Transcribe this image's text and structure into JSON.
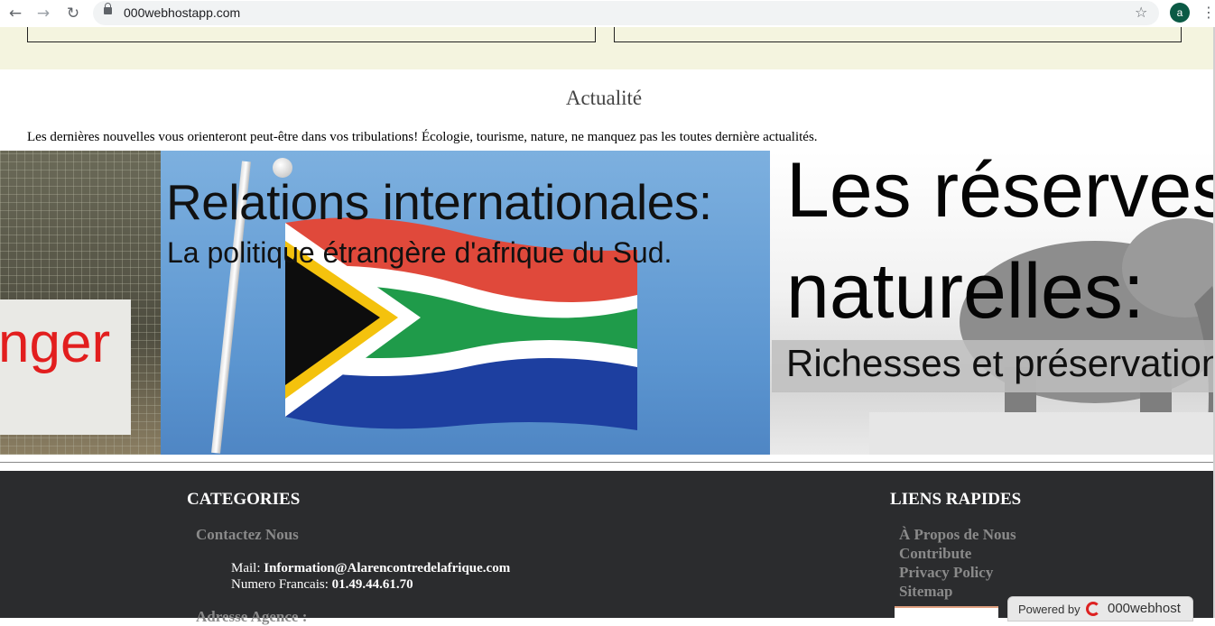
{
  "browser": {
    "url": "000webhostapp.com",
    "back_icon": "←",
    "forward_icon": "→",
    "reload_icon": "↻",
    "star_icon": "☆",
    "profile_initial": "a",
    "menu_icon": "⋮"
  },
  "news": {
    "title": "Actualité",
    "intro": "Les dernières nouvelles vous orienteront peut-être dans vos tribulations! Écologie, tourisme, nature, ne manquez pas les toutes dernière actualités.",
    "slides": {
      "left": {
        "text": "nger"
      },
      "middle": {
        "heading": "Relations internationales:",
        "subheading": "La politique étrangère d'afrique du Sud."
      },
      "right": {
        "line1": "Les réserves",
        "line2": "naturelles:",
        "tagline": "Richesses et préservation."
      }
    }
  },
  "footer": {
    "categories": {
      "heading": "CATEGORIES",
      "contact_link": "Contactez Nous",
      "mail_label": "Mail:",
      "mail_value": "Information@Alarencontredelafrique.com",
      "phone_label": "Numero Francais:",
      "phone_value": "01.49.44.61.70",
      "address_partial": "Adresse Agence :"
    },
    "quick_links": {
      "heading": "LIENS RAPIDES",
      "items": [
        "À Propos de Nous",
        "Contribute",
        "Privacy Policy",
        "Sitemap"
      ]
    }
  },
  "badge": {
    "powered_by": "Powered by",
    "brand": "000webhost"
  },
  "colors": {
    "band": "#f4f4df",
    "footer": "#2b2c2e",
    "link_gray": "#8a8a8a"
  }
}
